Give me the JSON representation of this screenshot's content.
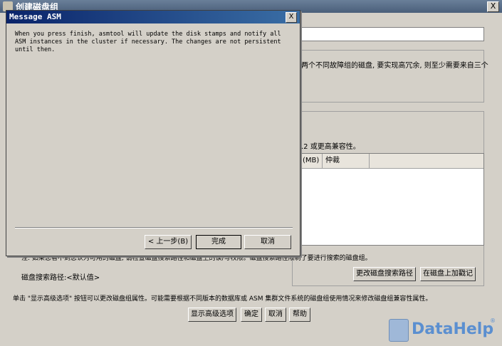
{
  "main_window": {
    "title": "创建磁盘组",
    "close_label": "X",
    "redundancy_text": "两个不同故障组的磁盘, 要实现高冗余, 则至少需要来自三个",
    "compat_text": ".2 或更高兼容性。",
    "table": {
      "headers": [
        "(MB)",
        "仲裁"
      ]
    },
    "note_text": "注: 如果您看不到您认为可用的磁盘, 请检查磁盘搜索路径和磁盘上的读/写权限。磁盘搜索路径限制了要进行搜索的磁盘组。",
    "search_path_label": "磁盘搜索路径:<默认值>",
    "change_path_button": "更改磁盘搜索路径",
    "stamp_disk_button": "在磁盘上加戳记",
    "footer_text": "单击 \"显示高级选项\" 按钮可以更改磁盘组属性。可能需要根据不同版本的数据库或 ASM 集群文件系统的磁盘组使用情况来修改磁盘组兼容性属性。",
    "show_advanced_button": "显示高级选项",
    "ok_button": "确定",
    "cancel_button": "取消",
    "help_button": "帮助"
  },
  "dialog": {
    "title": "Message ASM",
    "close_label": "X",
    "message": "When you press finish, asmtool will update the disk stamps and notify all ASM instances in the cluster if necessary. The changes are not persistent until then.",
    "back_button": "< 上一步(B)",
    "finish_button": "完成",
    "cancel_button": "取消"
  },
  "watermark": {
    "text": "DataHelp",
    "mark": "®"
  }
}
